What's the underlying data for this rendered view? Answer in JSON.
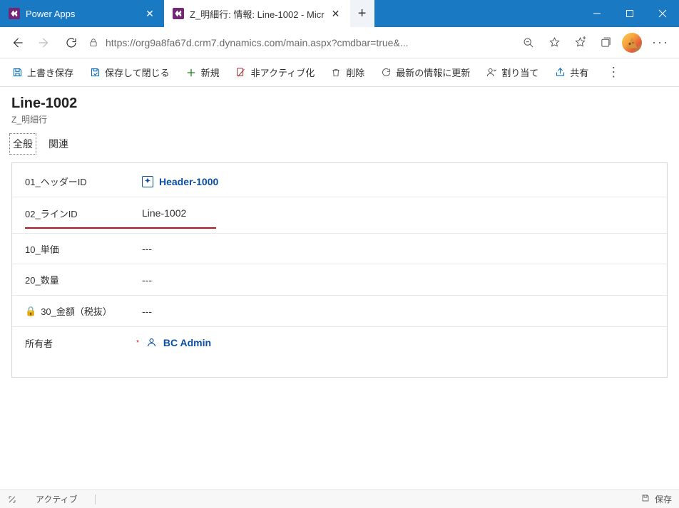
{
  "browser": {
    "tabs": [
      {
        "title": "Power Apps",
        "active": false
      },
      {
        "title": "Z_明細行: 情報: Line-1002 - Micr",
        "active": true
      }
    ],
    "url": "https://org9a8fa67d.crm7.dynamics.com/main.aspx?cmdbar=true&..."
  },
  "commands": {
    "save": "上書き保存",
    "save_close": "保存して閉じる",
    "new": "新規",
    "deactivate": "非アクティブ化",
    "delete": "削除",
    "refresh": "最新の情報に更新",
    "assign": "割り当て",
    "share": "共有"
  },
  "record": {
    "title": "Line-1002",
    "subtitle": "Z_明細行"
  },
  "tabs": {
    "general": "全般",
    "related": "関連"
  },
  "fields": {
    "header_id": {
      "label": "01_ヘッダーID",
      "value": "Header-1000"
    },
    "line_id": {
      "label": "02_ラインID",
      "value": "Line-1002"
    },
    "unit_price": {
      "label": "10_単価",
      "value": "---"
    },
    "quantity": {
      "label": "20_数量",
      "value": "---"
    },
    "amount": {
      "label": "30_金額（税抜）",
      "value": "---"
    },
    "owner": {
      "label": "所有者",
      "value": "BC Admin"
    }
  },
  "status": {
    "state": "アクティブ",
    "save": "保存"
  }
}
